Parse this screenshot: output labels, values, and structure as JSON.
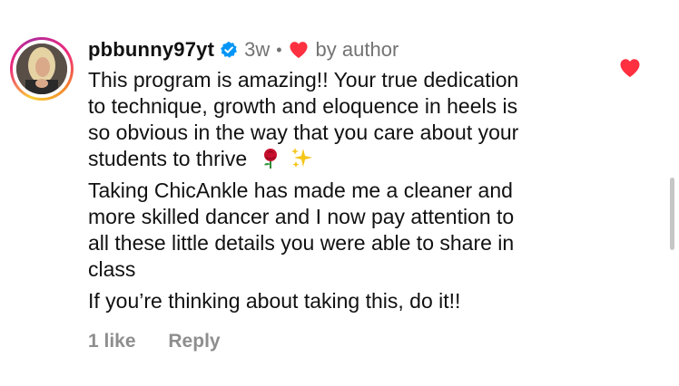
{
  "comment": {
    "username": "pbbunny97yt",
    "verified_icon": "verified-badge-icon",
    "time_ago": "3w",
    "separator": "•",
    "author_heart_icon": "heart-icon",
    "by_author": "by author",
    "body_lines_p1": [
      "This program is amazing!! Your true dedication",
      "to technique, growth and eloquence in heels is",
      "so obvious in the way that you care about your",
      "students to thrive"
    ],
    "emoji_p1": [
      "rose-emoji",
      "sparkles-emoji"
    ],
    "body_lines_p2": [
      "Taking ChicAnkle has made me a cleaner and",
      "more skilled dancer and I now pay attention to",
      "all these little details you were able to share in",
      "class"
    ],
    "body_lines_p3": [
      "If you’re thinking about taking this, do it!!"
    ],
    "likes": "1 like",
    "reply": "Reply",
    "like_icon": "heart-icon"
  },
  "colors": {
    "heart_red": "#ff3040",
    "verified_blue": "#0095f6",
    "meta_gray": "#737373",
    "action_gray": "#8e8e8e"
  }
}
